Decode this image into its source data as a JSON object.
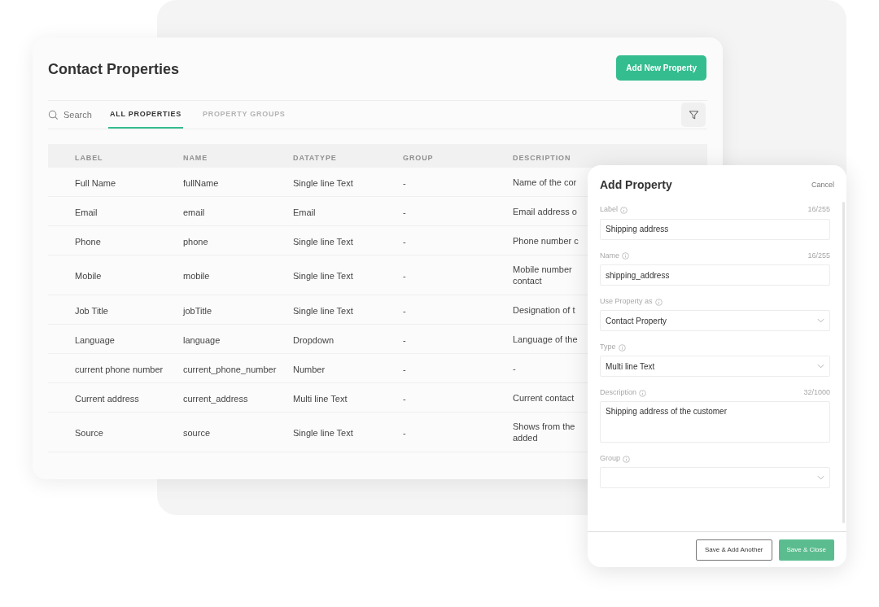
{
  "page": {
    "title": "Contact Properties",
    "add_button": "Add New Property"
  },
  "toolbar": {
    "search_placeholder": "Search",
    "tabs": [
      {
        "label": "ALL PROPERTIES",
        "selected": true
      },
      {
        "label": "PROPERTY GROUPS",
        "selected": false
      }
    ]
  },
  "table": {
    "columns": [
      "LABEL",
      "NAME",
      "DATATYPE",
      "GROUP",
      "DESCRIPTION"
    ],
    "rows": [
      {
        "label": "Full Name",
        "name": "fullName",
        "datatype": "Single line Text",
        "group": "-",
        "description": [
          "Name of the cor"
        ]
      },
      {
        "label": "Email",
        "name": "email",
        "datatype": "Email",
        "group": "-",
        "description": [
          "Email address o"
        ]
      },
      {
        "label": "Phone",
        "name": "phone",
        "datatype": "Single line Text",
        "group": "-",
        "description": [
          "Phone number c"
        ]
      },
      {
        "label": "Mobile",
        "name": "mobile",
        "datatype": "Single line Text",
        "group": "-",
        "description": [
          "Mobile number",
          "contact"
        ]
      },
      {
        "label": "Job Title",
        "name": "jobTitle",
        "datatype": "Single line Text",
        "group": "-",
        "description": [
          "Designation of t"
        ]
      },
      {
        "label": "Language",
        "name": "language",
        "datatype": "Dropdown",
        "group": "-",
        "description": [
          "Language of the"
        ]
      },
      {
        "label": "current phone number",
        "name": "current_phone_number",
        "datatype": "Number",
        "group": "-",
        "description": [
          "-"
        ]
      },
      {
        "label": "Current address",
        "name": "current_address",
        "datatype": "Multi line Text",
        "group": "-",
        "description": [
          "Current contact"
        ]
      },
      {
        "label": "Source",
        "name": "source",
        "datatype": "Single line Text",
        "group": "-",
        "description": [
          "Shows from the",
          "added"
        ]
      }
    ]
  },
  "panel": {
    "title": "Add Property",
    "cancel": "Cancel",
    "fields": [
      {
        "kind": "text",
        "label": "Label",
        "counter": "16/255",
        "value": "Shipping address"
      },
      {
        "kind": "text",
        "label": "Name",
        "counter": "16/255",
        "value": "shipping_address"
      },
      {
        "kind": "select",
        "label": "Use Property as",
        "value": "Contact Property"
      },
      {
        "kind": "select",
        "label": "Type",
        "value": "Multi line Text"
      },
      {
        "kind": "textarea",
        "label": "Description",
        "counter": "32/1000",
        "value": "Shipping address of the customer"
      },
      {
        "kind": "select",
        "label": "Group"
      }
    ],
    "buttons": [
      {
        "label": "Save & Add Another",
        "kind": "secondary"
      },
      {
        "label": "Save & Close",
        "kind": "primary"
      }
    ]
  }
}
